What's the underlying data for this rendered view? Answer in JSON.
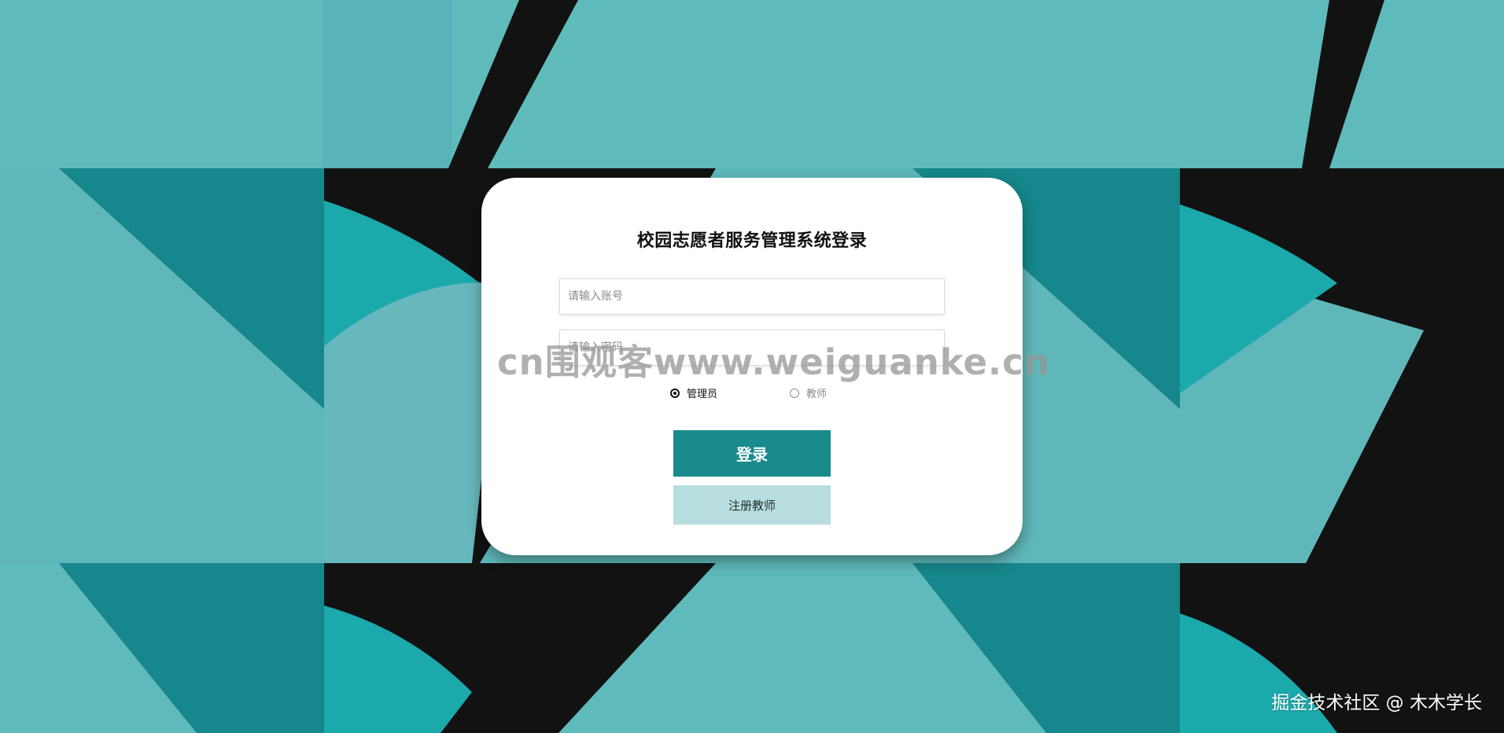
{
  "login": {
    "title": "校园志愿者服务管理系统登录",
    "account_placeholder": "请输入账号",
    "password_placeholder": "请输入密码",
    "role_admin_label": "管理员",
    "role_teacher_label": "教师",
    "selected_role": "管理员",
    "login_label": "登录",
    "register_label": "注册教师"
  },
  "watermark": {
    "text": "cn围观客www.weiguanke.cn"
  },
  "credit": {
    "text": "掘金技术社区 @ 木木学长"
  },
  "colors": {
    "primary": "#1a8b8c",
    "secondary_button": "#b9dedf",
    "background_teal": "#5fb7b9",
    "background_dark": "#121212"
  }
}
